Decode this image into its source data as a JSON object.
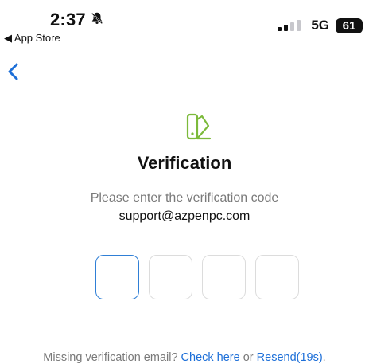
{
  "status_bar": {
    "time": "2:37",
    "back_label": "◀ App Store",
    "network": "5G",
    "battery": "61"
  },
  "page": {
    "title": "Verification",
    "subtitle": "Please enter the verification code",
    "email": "support@azpenpc.com"
  },
  "code_inputs": [
    "",
    "",
    "",
    ""
  ],
  "footer": {
    "missing_text": "Missing verification email? ",
    "check_label": "Check here",
    "or_text": " or ",
    "resend_label": "Resend(19s)",
    "period": "."
  },
  "colors": {
    "accent": "#2f7fd6",
    "icon_green": "#7cba3b"
  }
}
